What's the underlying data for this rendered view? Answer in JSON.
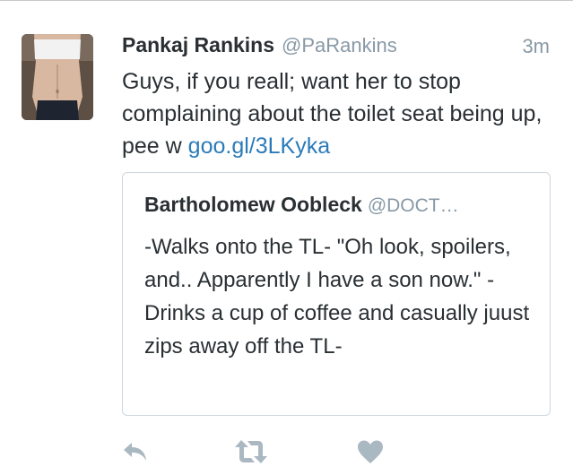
{
  "tweet": {
    "author": {
      "name": "Pankaj Rankins",
      "handle": "@PaRankins"
    },
    "timestamp": "3m",
    "text": "Guys, if you reall; want her to stop complaining about the toilet seat being up, pee w",
    "link": "goo.gl/3LKyka",
    "avatar_icon": "profile-photo"
  },
  "quote": {
    "name": "Bartholomew Oobleck",
    "handle": "@DOCT…",
    "text": "-Walks onto the TL- \"Oh look, spoilers, and.. Apparently I have a son now.\" -Drinks a cup of coffee and casually juust zips away off the TL-"
  },
  "actions": {
    "reply_icon": "reply-icon",
    "retweet_icon": "retweet-icon",
    "like_icon": "heart-icon",
    "icon_color": "#aab8c2"
  }
}
